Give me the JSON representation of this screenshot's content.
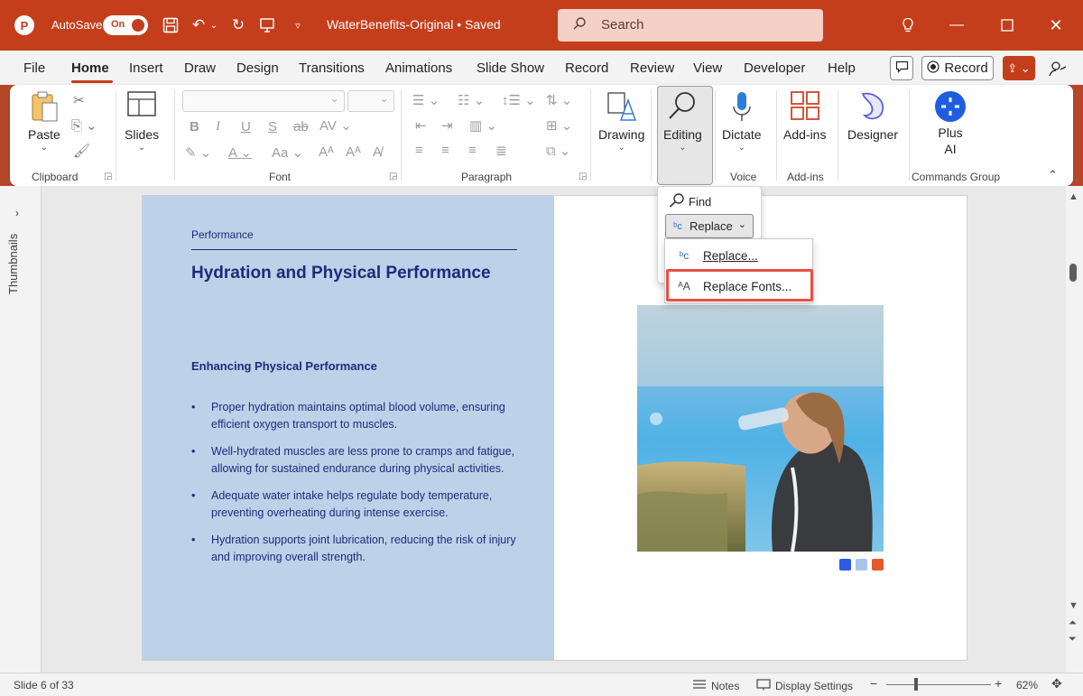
{
  "titlebar": {
    "app_icon": "powerpoint-logo",
    "autosave_label": "AutoSave",
    "autosave_state": "On",
    "document_title": "WaterBenefits-Original • Saved",
    "search_placeholder": "Search"
  },
  "tabs": [
    "File",
    "Home",
    "Insert",
    "Draw",
    "Design",
    "Transitions",
    "Animations",
    "Slide Show",
    "Record",
    "Review",
    "View",
    "Developer",
    "Help"
  ],
  "active_tab": "Home",
  "menubar": {
    "record_label": "Record"
  },
  "ribbon": {
    "paste_label": "Paste",
    "slides_label": "Slides",
    "drawing_label": "Drawing",
    "editing_label": "Editing",
    "dictate_label": "Dictate",
    "addins_label": "Add-ins",
    "designer_label": "Designer",
    "plusai_line1": "Plus",
    "plusai_line2": "AI",
    "groups": {
      "clipboard": "Clipboard",
      "font": "Font",
      "paragraph": "Paragraph",
      "voice": "Voice",
      "addins": "Add-ins",
      "commands": "Commands Group"
    }
  },
  "editing_menu": {
    "find_label": "Find",
    "replace_label": "Replace",
    "submenu": {
      "replace_item": "Replace...",
      "replace_fonts_item": "Replace Fonts..."
    }
  },
  "thumbnails_label": "Thumbnails",
  "slide": {
    "kicker": "Performance",
    "title": "Hydration and Physical Performance",
    "subtitle": "Enhancing Physical Performance",
    "bullets": [
      "Proper hydration maintains optimal blood volume, ensuring efficient oxygen transport to muscles.",
      "Well-hydrated muscles are less prone to cramps and fatigue, allowing for sustained endurance during physical activities.",
      "Adequate water intake helps regulate body temperature, preventing overheating during intense exercise.",
      "Hydration supports joint lubrication, reducing the risk of injury and improving overall strength."
    ],
    "accent_colors": [
      "#2c5be8",
      "#a9c4ea",
      "#e55a2b"
    ]
  },
  "statusbar": {
    "slide_info": "Slide 6 of 33",
    "notes_label": "Notes",
    "display_settings_label": "Display Settings",
    "zoom_percent": "62%",
    "zoom_level": 0.62
  },
  "colors": {
    "accent": "#c43e1c",
    "slide_panel": "#bdd1e9",
    "slide_text": "#1f2a7a",
    "highlight": "#e94f44"
  }
}
